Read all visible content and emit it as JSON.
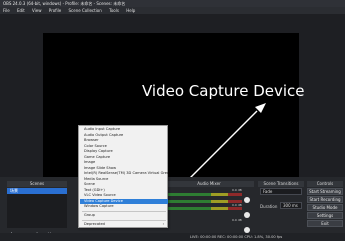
{
  "window": {
    "title": "OBS 24.0.3 (64-bit, windows) - Profile: 未命名 - Scenes: 未命名"
  },
  "menubar": [
    "File",
    "Edit",
    "View",
    "Profile",
    "Scene Collection",
    "Tools",
    "Help"
  ],
  "preview": {
    "annotation": "Video Capture Device"
  },
  "docks": {
    "scenes": "Scenes",
    "mixer": "Audio Mixer",
    "transitions": "Scene Transitions",
    "controls": "Controls"
  },
  "scenes": {
    "items": [
      "场景"
    ]
  },
  "scene_tools": "+ − ∧ ∨",
  "source_menu": {
    "items": [
      "Audio Input Capture",
      "Audio Output Capture",
      "Browser",
      "Color Source",
      "Display Capture",
      "Game Capture",
      "Image",
      "Image Slide Show",
      "Intel(R) RealSense(TM) 3D Camera Virtual Green Screen",
      "Media Source",
      "Scene",
      "Text (GDI+)",
      "VLC Video Source",
      "Video Capture Device",
      "Window Capture",
      "Group",
      "Deprecated"
    ],
    "selected": "Video Capture Device",
    "deprecated_arrow": "›"
  },
  "transitions": {
    "type_value": "Fade",
    "duration_label": "Duration",
    "duration_value": "300 ms"
  },
  "controls": {
    "buttons": [
      "Start Streaming",
      "Start Recording",
      "Studio Mode",
      "Settings",
      "Exit"
    ]
  },
  "mixer": {
    "db_values": [
      "0.0 dB",
      "0.0 dB",
      "0.0 dB"
    ]
  },
  "status_bar": "LIVE: 00:00:00    REC: 00:00:00    CPU: 1.8%, 30.00 fps",
  "colors": {
    "background": "#1e1f23",
    "selection": "#2f7fd8",
    "annotation": "#ffffff"
  }
}
